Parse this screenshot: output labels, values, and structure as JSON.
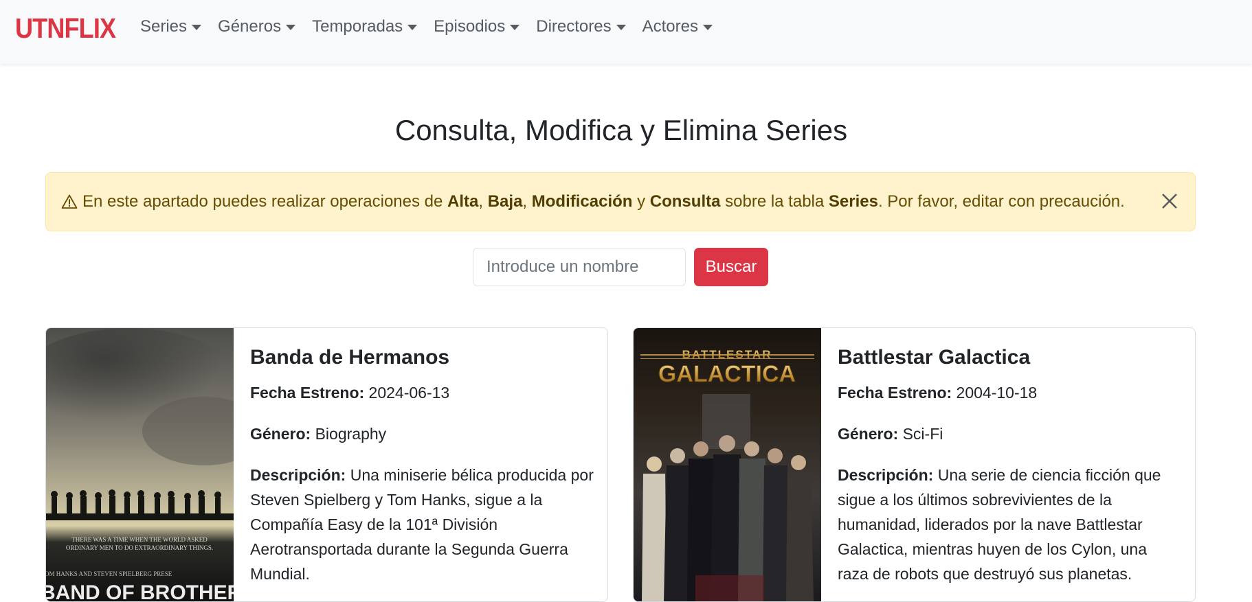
{
  "navbar": {
    "brand": "UTNFLIX",
    "items": [
      {
        "label": "Series"
      },
      {
        "label": "Géneros"
      },
      {
        "label": "Temporadas"
      },
      {
        "label": "Episodios"
      },
      {
        "label": "Directores"
      },
      {
        "label": "Actores"
      }
    ]
  },
  "page_title": "Consulta, Modifica y Elimina Series",
  "alert": {
    "text_1": "En este apartado puedes realizar operaciones de",
    "alta": "Alta",
    "sep_1": ",",
    "baja": "Baja",
    "sep_2": ",",
    "modificacion": "Modificación",
    "y": "y",
    "consulta": "Consulta",
    "text_2": "sobre la tabla",
    "series": "Series",
    "text_3": ". Por favor, editar con precaución."
  },
  "search": {
    "placeholder": "Introduce un nombre",
    "button_label": "Buscar"
  },
  "cards": [
    {
      "title": "Banda de Hermanos",
      "fecha_label": "Fecha Estreno:",
      "fecha": "2024-06-13",
      "genero_label": "Género:",
      "genero": "Biography",
      "descripcion_label": "Descripción:",
      "descripcion": "Una miniserie bélica producida por Steven Spielberg y Tom Hanks, sigue a la Compañía Easy de la 101ª División Aerotransportada durante la Segunda Guerra Mundial.",
      "poster_tagline_1": "THERE WAS A TIME WHEN THE WORLD ASKED",
      "poster_tagline_2": "ORDINARY MEN TO DO EXTRAORDINARY THINGS.",
      "poster_credit": "OM HANKS AND STEVEN SPIELBERG PRESE",
      "poster_logo": "BAND OF BROTHERS"
    },
    {
      "title": "Battlestar Galactica",
      "fecha_label": "Fecha Estreno:",
      "fecha": "2004-10-18",
      "genero_label": "Género:",
      "genero": "Sci-Fi",
      "descripcion_label": "Descripción:",
      "descripcion": "Una serie de ciencia ficción que sigue a los últimos sobrevivientes de la humanidad, liderados por la nave Battlestar Galactica, mientras huyen de los Cylon, una raza de robots que destruyó sus planetas.",
      "poster_logo_1": "BATTLESTAR",
      "poster_logo_2": "GALACTICA"
    }
  ],
  "colors": {
    "brand": "#dc3545",
    "alert_bg": "#fff3cd",
    "alert_text": "#664d03",
    "button": "#dc3545"
  },
  "icons": {
    "alert": "warning-triangle-icon",
    "close": "close-icon",
    "dropdown": "caret-down-icon"
  }
}
